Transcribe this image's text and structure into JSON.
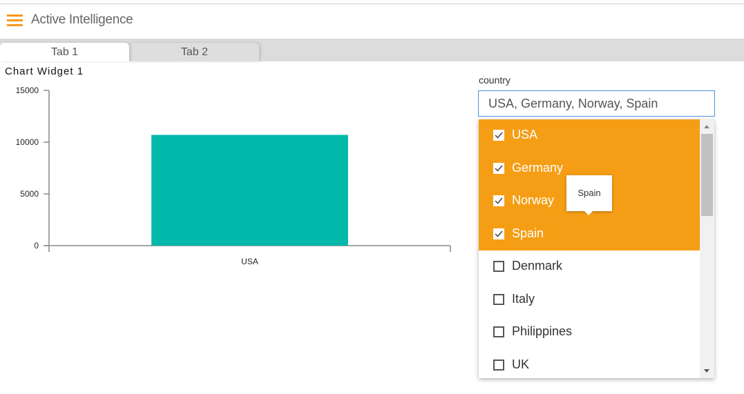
{
  "app": {
    "title": "Active Intelligence",
    "menu_icon": "hamburger-icon",
    "accent": "#f59a1b"
  },
  "tabs": [
    {
      "label": "Tab 1",
      "active": true
    },
    {
      "label": "Tab 2",
      "active": false
    }
  ],
  "widget": {
    "title": "Chart Widget 1"
  },
  "chart_data": {
    "type": "bar",
    "categories": [
      "USA"
    ],
    "values": [
      10700
    ],
    "ylim": [
      0,
      15000
    ],
    "yticks": [
      "0",
      "5000",
      "10000",
      "15000"
    ],
    "color": "#02b8ab",
    "grid": false
  },
  "filter": {
    "label": "country",
    "value": "USA, Germany, Norway, Spain",
    "options": [
      {
        "label": "USA",
        "checked": true
      },
      {
        "label": "Germany",
        "checked": true
      },
      {
        "label": "Norway",
        "checked": true
      },
      {
        "label": "Spain",
        "checked": true
      },
      {
        "label": "Denmark",
        "checked": false
      },
      {
        "label": "Italy",
        "checked": false
      },
      {
        "label": "Philippines",
        "checked": false
      },
      {
        "label": "UK",
        "checked": false
      }
    ],
    "selected_color": "#f59e15",
    "tooltip": "Spain"
  }
}
